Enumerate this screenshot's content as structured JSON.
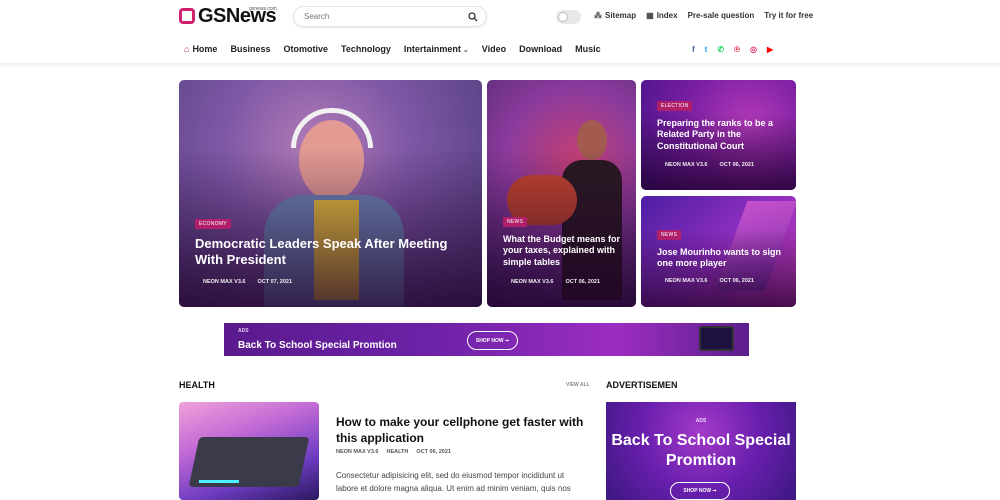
{
  "header": {
    "logo_text": "GSNews",
    "logo_sub": "gsnews.com",
    "search_placeholder": "Search",
    "links": [
      {
        "label": "Sitemap",
        "icon": "sitemap-icon"
      },
      {
        "label": "Index",
        "icon": "index-icon"
      },
      {
        "label": "Pre-sale question"
      },
      {
        "label": "Try it for free"
      }
    ]
  },
  "nav": {
    "items": [
      "Home",
      "Business",
      "Otomotive",
      "Technology",
      "Intertainment",
      "Video",
      "Download",
      "Music"
    ],
    "socials": [
      {
        "icon": "facebook-icon",
        "glyph": "f",
        "color": "#3b5998"
      },
      {
        "icon": "twitter-icon",
        "glyph": "t",
        "color": "#1da1f2"
      },
      {
        "icon": "whatsapp-icon",
        "glyph": "w",
        "color": "#25d366"
      },
      {
        "icon": "pinterest-icon",
        "glyph": "p",
        "color": "#e60023"
      },
      {
        "icon": "instagram-icon",
        "glyph": "◎",
        "color": "#e1306c"
      },
      {
        "icon": "youtube-icon",
        "glyph": "▶",
        "color": "#ff0000"
      }
    ]
  },
  "hero": [
    {
      "badge": "ECONOMY",
      "title": "Democratic Leaders Speak After Meeting With President",
      "author": "NEON MAX V3.6",
      "date": "OCT 07, 2021"
    },
    {
      "badge": "NEWS",
      "title": "What the Budget means for your taxes, explained with simple tables",
      "author": "NEON MAX V3.6",
      "date": "OCT 06, 2021"
    },
    {
      "badge": "ELECTION",
      "title": "Preparing the ranks to be a Related Party in the Constitutional Court",
      "author": "NEON MAX V3.6",
      "date": "OCT 06, 2021"
    },
    {
      "badge": "NEWS",
      "title": "Jose Mourinho wants to sign one more player",
      "author": "NEON MAX V3.6",
      "date": "OCT 06, 2021"
    }
  ],
  "banner": {
    "small": "ADS",
    "title": "Back To School Special Promtion",
    "button": "SHOP NOW ➞"
  },
  "health": {
    "heading": "HEALTH",
    "view_all": "VIEW ALL",
    "article": {
      "title": "How to make your cellphone get faster with this application",
      "author": "NEON MAX V3.6",
      "category": "HEALTH",
      "date": "OCT 06, 2021",
      "desc": "Consectetur adipisicing elit, sed do eiusmod tempor incididunt ut labore et dolore magna aliqua. Ut enim ad minim veniam, quis nos"
    }
  },
  "advert": {
    "heading": "ADVERTISEMEN",
    "small": "ADS",
    "title": "Back To School Special Promtion",
    "button": "SHOP NOW ➞"
  }
}
